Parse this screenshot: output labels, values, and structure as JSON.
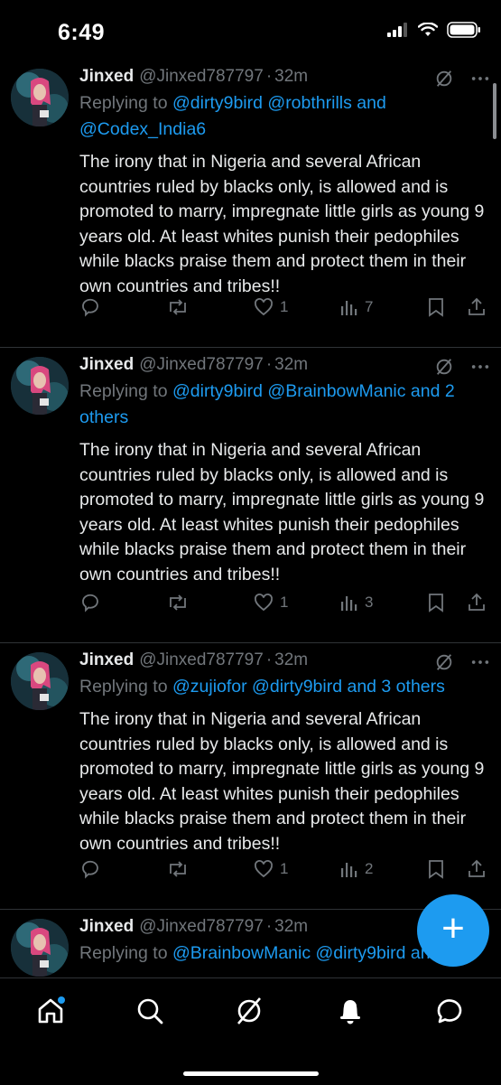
{
  "status_bar": {
    "time": "6:49"
  },
  "tweets": [
    {
      "name": "Jinxed",
      "handle": "@Jinxed787797",
      "separator": "·",
      "age": "32m",
      "reply_prefix": "Replying to",
      "reply_line1_links": "@dirty9bird @robthrills and",
      "reply_line2_links": "@Codex_India6",
      "body": "The irony that in Nigeria and several African countries ruled by blacks only, is allowed and is promoted to marry, impregnate little girls as young 9 years old. At least whites punish their pedophiles while blacks praise them and protect them in their own countries and tribes!!",
      "likes": "1",
      "views": "7"
    },
    {
      "name": "Jinxed",
      "handle": "@Jinxed787797",
      "separator": "·",
      "age": "32m",
      "reply_prefix": "Replying to",
      "reply_line1_links": "@dirty9bird @BrainbowManic and 2",
      "reply_line2_links": "others",
      "body": "The irony that in Nigeria and several African countries ruled by blacks only, is allowed and is promoted to marry, impregnate little girls as young 9 years old. At least whites punish their pedophiles while blacks praise them and protect them in their own countries and tribes!!",
      "likes": "1",
      "views": "3"
    },
    {
      "name": "Jinxed",
      "handle": "@Jinxed787797",
      "separator": "·",
      "age": "32m",
      "reply_prefix": "Replying to",
      "reply_line1_links": "@zujiofor @dirty9bird and 3 others",
      "body": "The irony that in Nigeria and several African countries ruled by blacks only, is allowed and is promoted to marry, impregnate little girls as young 9 years old. At least whites punish their pedophiles while blacks praise them and protect them in their own countries and tribes!!",
      "likes": "1",
      "views": "2"
    },
    {
      "name": "Jinxed",
      "handle": "@Jinxed787797",
      "separator": "·",
      "age": "32m",
      "reply_prefix": "Replying to",
      "reply_line1_links": "@BrainbowManic @dirty9bird and 3"
    }
  ],
  "colors": {
    "accent": "#1d9bf0",
    "muted": "#71767b",
    "text": "#e7e9ea",
    "background": "#000000",
    "divider": "#2f3336"
  },
  "icons": {
    "header": [
      "grok-icon",
      "more-icon"
    ],
    "actions": [
      "reply-icon",
      "retweet-icon",
      "like-icon",
      "views-icon",
      "bookmark-icon",
      "share-icon"
    ],
    "nav": [
      "home-icon",
      "search-icon",
      "grok-icon",
      "notifications-icon",
      "messages-icon"
    ],
    "fab": "compose-plus-icon"
  },
  "fab": {
    "label": "+"
  }
}
